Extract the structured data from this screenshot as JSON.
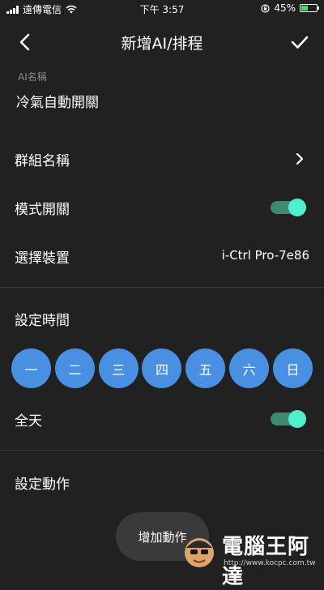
{
  "status_bar": {
    "carrier": "遠傳電信",
    "time": "下午 3:57",
    "battery_percent": "45%",
    "battery_level": 0.45
  },
  "nav": {
    "title": "新增AI/排程"
  },
  "ai_name": {
    "label": "AI名稱",
    "value": "冷氣自動開關"
  },
  "group": {
    "label": "群組名稱"
  },
  "mode_switch": {
    "label": "模式開關",
    "on": true
  },
  "device": {
    "label": "選擇裝置",
    "value": "i-Ctrl Pro-7e86"
  },
  "schedule": {
    "title": "設定時間",
    "days": [
      "一",
      "二",
      "三",
      "四",
      "五",
      "六",
      "日"
    ]
  },
  "all_day": {
    "label": "全天",
    "on": true
  },
  "action": {
    "title": "設定動作",
    "add_button": "增加動作"
  },
  "watermark": {
    "text": "電腦王阿達",
    "url": "http://www.kocpc.com.tw"
  },
  "colors": {
    "background": "#212121",
    "day_circle": "#4a90e2",
    "toggle_track": "#3d8a73",
    "toggle_knob": "#4ff0cb",
    "battery": "#4cd964"
  }
}
